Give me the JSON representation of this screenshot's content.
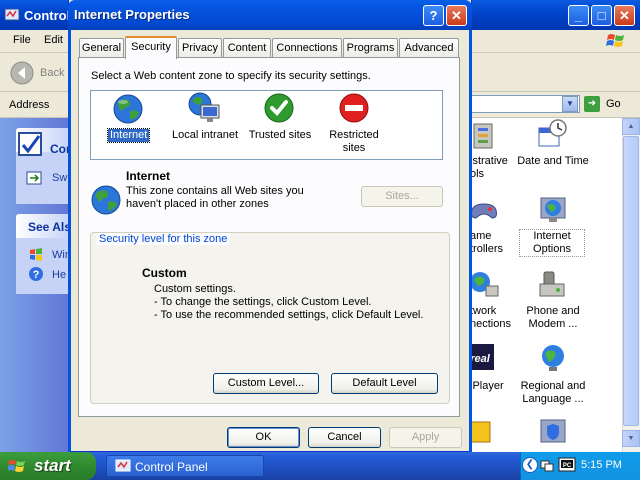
{
  "background_window": {
    "title": "Control Panel",
    "menu": [
      "File",
      "Edit"
    ],
    "toolbar_back": "Back",
    "address_label": "Address",
    "go_label": "Go",
    "left_panel": {
      "header_partial": "Con",
      "switch_partial": "Sw",
      "see_also_partial": "See Als",
      "item1_partial": "Win",
      "item2_partial": "He"
    },
    "icons": [
      {
        "label_lines": [
          "istrative",
          "ols"
        ],
        "icon": "admin-tools-icon"
      },
      {
        "label_lines": [
          "Date and Time"
        ],
        "icon": "date-time-icon"
      },
      {
        "label_lines": [
          "ame",
          "trollers"
        ],
        "icon": "game-controllers-icon"
      },
      {
        "label_lines": [
          "Internet",
          "Options"
        ],
        "icon": "internet-options-icon"
      },
      {
        "label_lines": [
          "twork",
          "nections"
        ],
        "icon": "network-icon"
      },
      {
        "label_lines": [
          "Phone and",
          "Modem ..."
        ],
        "icon": "phone-modem-icon"
      },
      {
        "label_lines": [
          "lPlayer"
        ],
        "icon": "realplayer-icon"
      },
      {
        "label_lines": [
          "Regional and",
          "Language ..."
        ],
        "icon": "regional-icon"
      }
    ]
  },
  "dialog": {
    "title": "Internet Properties",
    "help_glyph": "?",
    "close_glyph": "✕",
    "tabs": [
      "General",
      "Security",
      "Privacy",
      "Content",
      "Connections",
      "Programs",
      "Advanced"
    ],
    "active_tab": "Security",
    "instruction": "Select a Web content zone to specify its security settings.",
    "zones": [
      {
        "label_lines": [
          "Internet"
        ],
        "selected": true,
        "icon": "globe-icon"
      },
      {
        "label_lines": [
          "Local intranet"
        ],
        "selected": false,
        "icon": "intranet-icon"
      },
      {
        "label_lines": [
          "Trusted sites"
        ],
        "selected": false,
        "icon": "check-icon"
      },
      {
        "label_lines": [
          "Restricted",
          "sites"
        ],
        "selected": false,
        "icon": "restricted-icon"
      }
    ],
    "zone_info": {
      "name": "Internet",
      "description_lines": [
        "This zone contains all Web sites you",
        "haven't placed in other zones"
      ],
      "sites_button": "Sites..."
    },
    "security_group": {
      "legend": "Security level for this zone",
      "level_name": "Custom",
      "lines": [
        "Custom settings.",
        "- To change the settings, click Custom Level.",
        "- To use the recommended settings, click Default Level."
      ],
      "custom_level_button": "Custom Level...",
      "default_level_button": "Default Level"
    },
    "buttons": {
      "ok": "OK",
      "cancel": "Cancel",
      "apply": "Apply"
    }
  },
  "taskbar": {
    "start_label": "start",
    "task_button": "Control Panel",
    "clock": "5:15 PM"
  },
  "colors": {
    "title_blue": "#0054e3",
    "dialog_face": "#ece9d8",
    "selection": "#316ac5",
    "start_green": "#3c9d3c",
    "tab_accent": "#e68b2c"
  }
}
